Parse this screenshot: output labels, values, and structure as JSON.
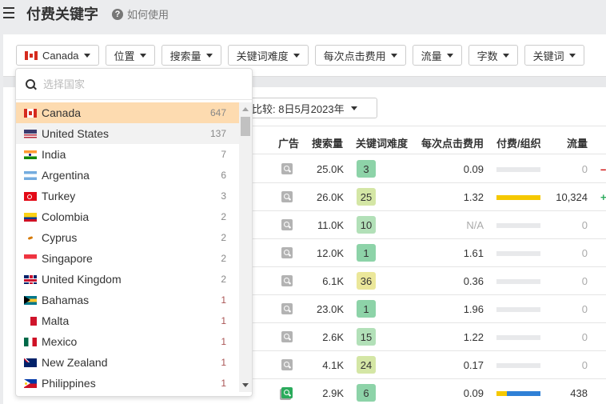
{
  "header": {
    "title": "付费关键字",
    "help_label": "如何使用",
    "help_icon": "question-circle-icon",
    "menu_icon": "hamburger-icon"
  },
  "filters": [
    {
      "label": "Canada",
      "flag": "ca"
    },
    {
      "label": "位置"
    },
    {
      "label": "搜索量"
    },
    {
      "label": "关键词难度"
    },
    {
      "label": "每次点击费用"
    },
    {
      "label": "流量"
    },
    {
      "label": "字数"
    },
    {
      "label": "关键词"
    }
  ],
  "compare": {
    "label": "比较:",
    "value": "8日5月2023年",
    "display": "比较:  8日5月2023年"
  },
  "table": {
    "columns": [
      "广告",
      "搜索量",
      "关键词难度",
      "每次点击费用",
      "付费/组织",
      "流量"
    ],
    "rows": [
      {
        "ad_active": false,
        "volume": "25.0K",
        "kd": "3",
        "kd_color": "#8dd3a8",
        "cpc": "0.09",
        "paid_share": 0,
        "organic_share": 0,
        "traffic": "0",
        "trend": "–",
        "trend_color": "#cc0000"
      },
      {
        "ad_active": false,
        "volume": "26.0K",
        "kd": "25",
        "kd_color": "#d4e6a5",
        "cpc": "1.32",
        "paid_share": 1.0,
        "organic_share": 0,
        "traffic": "10,324",
        "trend": "+",
        "trend_color": "#2bab5c"
      },
      {
        "ad_active": false,
        "volume": "11.0K",
        "kd": "10",
        "kd_color": "#b2e0b8",
        "cpc": "N/A",
        "paid_share": 0,
        "organic_share": 0,
        "traffic": "0",
        "trend": "",
        "trend_color": ""
      },
      {
        "ad_active": false,
        "volume": "12.0K",
        "kd": "1",
        "kd_color": "#8dd3a8",
        "cpc": "1.61",
        "paid_share": 0,
        "organic_share": 0,
        "traffic": "0",
        "trend": "",
        "trend_color": ""
      },
      {
        "ad_active": false,
        "volume": "6.1K",
        "kd": "36",
        "kd_color": "#ebe79a",
        "cpc": "0.36",
        "paid_share": 0,
        "organic_share": 0,
        "traffic": "0",
        "trend": "",
        "trend_color": ""
      },
      {
        "ad_active": false,
        "volume": "23.0K",
        "kd": "1",
        "kd_color": "#8dd3a8",
        "cpc": "1.96",
        "paid_share": 0,
        "organic_share": 0,
        "traffic": "0",
        "trend": "",
        "trend_color": ""
      },
      {
        "ad_active": false,
        "volume": "2.6K",
        "kd": "15",
        "kd_color": "#b2e0b8",
        "cpc": "1.22",
        "paid_share": 0,
        "organic_share": 0,
        "traffic": "0",
        "trend": "",
        "trend_color": ""
      },
      {
        "ad_active": false,
        "volume": "4.1K",
        "kd": "24",
        "kd_color": "#d4e6a5",
        "cpc": "0.17",
        "paid_share": 0,
        "organic_share": 0,
        "traffic": "0",
        "trend": "",
        "trend_color": ""
      },
      {
        "ad_active": true,
        "volume": "2.9K",
        "kd": "6",
        "kd_color": "#8dd3a8",
        "cpc": "0.09",
        "paid_share": 0.24,
        "organic_share": 0.76,
        "traffic": "438",
        "trend": "",
        "trend_color": ""
      }
    ]
  },
  "country_dropdown": {
    "search_placeholder": "选择国家",
    "search_value": "",
    "items": [
      {
        "name": "Canada",
        "count": "647",
        "flag": "ca",
        "state": "selected"
      },
      {
        "name": "United States",
        "count": "137",
        "flag": "us",
        "state": "hover"
      },
      {
        "name": "India",
        "count": "7",
        "flag": "in",
        "state": ""
      },
      {
        "name": "Argentina",
        "count": "6",
        "flag": "ar",
        "state": ""
      },
      {
        "name": "Turkey",
        "count": "3",
        "flag": "tr",
        "state": ""
      },
      {
        "name": "Colombia",
        "count": "2",
        "flag": "co",
        "state": ""
      },
      {
        "name": "Cyprus",
        "count": "2",
        "flag": "cy",
        "state": ""
      },
      {
        "name": "Singapore",
        "count": "2",
        "flag": "sg",
        "state": ""
      },
      {
        "name": "United Kingdom",
        "count": "2",
        "flag": "gb",
        "state": ""
      },
      {
        "name": "Bahamas",
        "count": "1",
        "flag": "bs",
        "state": ""
      },
      {
        "name": "Malta",
        "count": "1",
        "flag": "mt",
        "state": ""
      },
      {
        "name": "Mexico",
        "count": "1",
        "flag": "mx",
        "state": ""
      },
      {
        "name": "New Zealand",
        "count": "1",
        "flag": "nz",
        "state": ""
      },
      {
        "name": "Philippines",
        "count": "1",
        "flag": "ph",
        "state": ""
      }
    ],
    "scroll_position": 0.0
  }
}
